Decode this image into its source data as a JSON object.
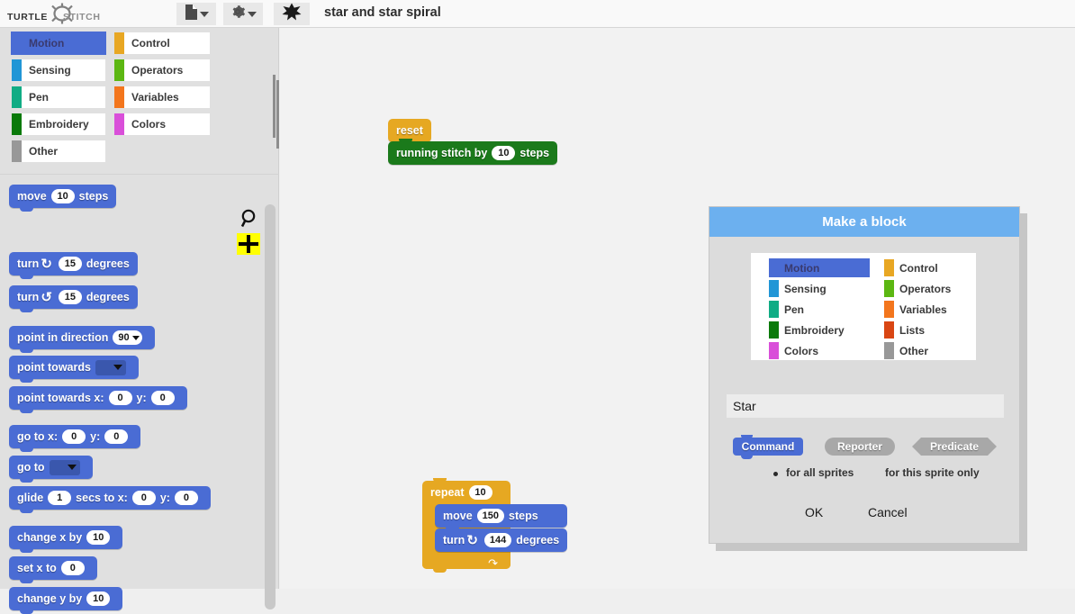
{
  "app": {
    "logo_primary": "TURTLE",
    "logo_secondary": "STITCH",
    "project_title": "star and star spiral"
  },
  "toolbar": {
    "file_icon": "file-page-icon",
    "settings_icon": "gear-icon",
    "star_icon": "star-splat-icon"
  },
  "palette": {
    "categories_col_a": [
      {
        "label": "Motion",
        "color": "#4a6cd4",
        "selected": true
      },
      {
        "label": "Sensing",
        "color": "#2196d6",
        "selected": false
      },
      {
        "label": "Pen",
        "color": "#10ac84",
        "selected": false
      },
      {
        "label": "Embroidery",
        "color": "#0a7a0a",
        "selected": false
      },
      {
        "label": "Other",
        "color": "#989898",
        "selected": false
      }
    ],
    "categories_col_b": [
      {
        "label": "Control",
        "color": "#e8a723",
        "selected": false
      },
      {
        "label": "Operators",
        "color": "#5cb712",
        "selected": false
      },
      {
        "label": "Variables",
        "color": "#f3761d",
        "selected": false
      },
      {
        "label": "Colors",
        "color": "#d94fd9",
        "selected": false
      }
    ],
    "search_icon": "search-icon",
    "add_icon": "plus-icon",
    "blocks": [
      {
        "id": "move",
        "parts": [
          "move",
          "10",
          "steps"
        ]
      },
      {
        "id": "turn-cw",
        "parts": [
          "turn",
          "15",
          "degrees"
        ]
      },
      {
        "id": "turn-ccw",
        "parts": [
          "turn",
          "15",
          "degrees"
        ]
      },
      {
        "id": "point-dir",
        "parts": [
          "point in direction",
          "90"
        ]
      },
      {
        "id": "point-tow",
        "parts": [
          "point towards"
        ]
      },
      {
        "id": "point-tow-xy",
        "parts": [
          "point towards x:",
          "0",
          "y:",
          "0"
        ]
      },
      {
        "id": "goto-xy",
        "parts": [
          "go to x:",
          "0",
          "y:",
          "0"
        ]
      },
      {
        "id": "goto",
        "parts": [
          "go to"
        ]
      },
      {
        "id": "glide",
        "parts": [
          "glide",
          "1",
          "secs to x:",
          "0",
          "y:",
          "0"
        ]
      },
      {
        "id": "change-x",
        "parts": [
          "change x by",
          "10"
        ]
      },
      {
        "id": "set-x",
        "parts": [
          "set x to",
          "0"
        ]
      },
      {
        "id": "change-y",
        "parts": [
          "change y by",
          "10"
        ]
      }
    ],
    "labels": {
      "move": "move",
      "steps": "steps",
      "turn": "turn",
      "degrees": "degrees",
      "point_in_direction": "point in direction",
      "point_towards": "point towards",
      "point_towards_x": "point towards x:",
      "y_colon": "y:",
      "go_to_x": "go to x:",
      "go_to": "go to",
      "glide": "glide",
      "secs_to_x": "secs to x:",
      "change_x_by": "change x by",
      "set_x_to": "set x to",
      "change_y_by": "change y by"
    },
    "values": {
      "move_steps": "10",
      "turn_cw_deg": "15",
      "turn_ccw_deg": "15",
      "direction": "90",
      "ptx": "0",
      "pty": "0",
      "gotox": "0",
      "gotoy": "0",
      "glide_secs": "1",
      "glide_x": "0",
      "glide_y": "0",
      "change_x": "10",
      "set_x": "0",
      "change_y": "10"
    }
  },
  "scripts": {
    "stack_a": {
      "reset": "reset",
      "running_stitch": "running stitch by",
      "running_stitch_value": "10",
      "running_stitch_tail": "steps"
    },
    "stack_b": {
      "repeat": "repeat",
      "repeat_value": "10",
      "move": "move",
      "move_value": "150",
      "move_tail": "steps",
      "turn": "turn",
      "turn_value": "144",
      "turn_tail": "degrees"
    }
  },
  "dialog": {
    "title": "Make a block",
    "categories_col_a": [
      {
        "label": "Motion",
        "color": "#4a6cd4",
        "selected": true
      },
      {
        "label": "Sensing",
        "color": "#2196d6",
        "selected": false
      },
      {
        "label": "Pen",
        "color": "#10ac84",
        "selected": false
      },
      {
        "label": "Embroidery",
        "color": "#0a7a0a",
        "selected": false
      },
      {
        "label": "Colors",
        "color": "#d94fd9",
        "selected": false
      }
    ],
    "categories_col_b": [
      {
        "label": "Control",
        "color": "#e8a723",
        "selected": false
      },
      {
        "label": "Operators",
        "color": "#5cb712",
        "selected": false
      },
      {
        "label": "Variables",
        "color": "#f3761d",
        "selected": false
      },
      {
        "label": "Lists",
        "color": "#d94613",
        "selected": false
      },
      {
        "label": "Other",
        "color": "#989898",
        "selected": false
      }
    ],
    "name_value": "Star",
    "name_placeholder": "",
    "type_command": "Command",
    "type_reporter": "Reporter",
    "type_predicate": "Predicate",
    "scope_all": "for all sprites",
    "scope_this": "for this sprite only",
    "ok": "OK",
    "cancel": "Cancel",
    "accent_color": "#6cb0ef"
  }
}
